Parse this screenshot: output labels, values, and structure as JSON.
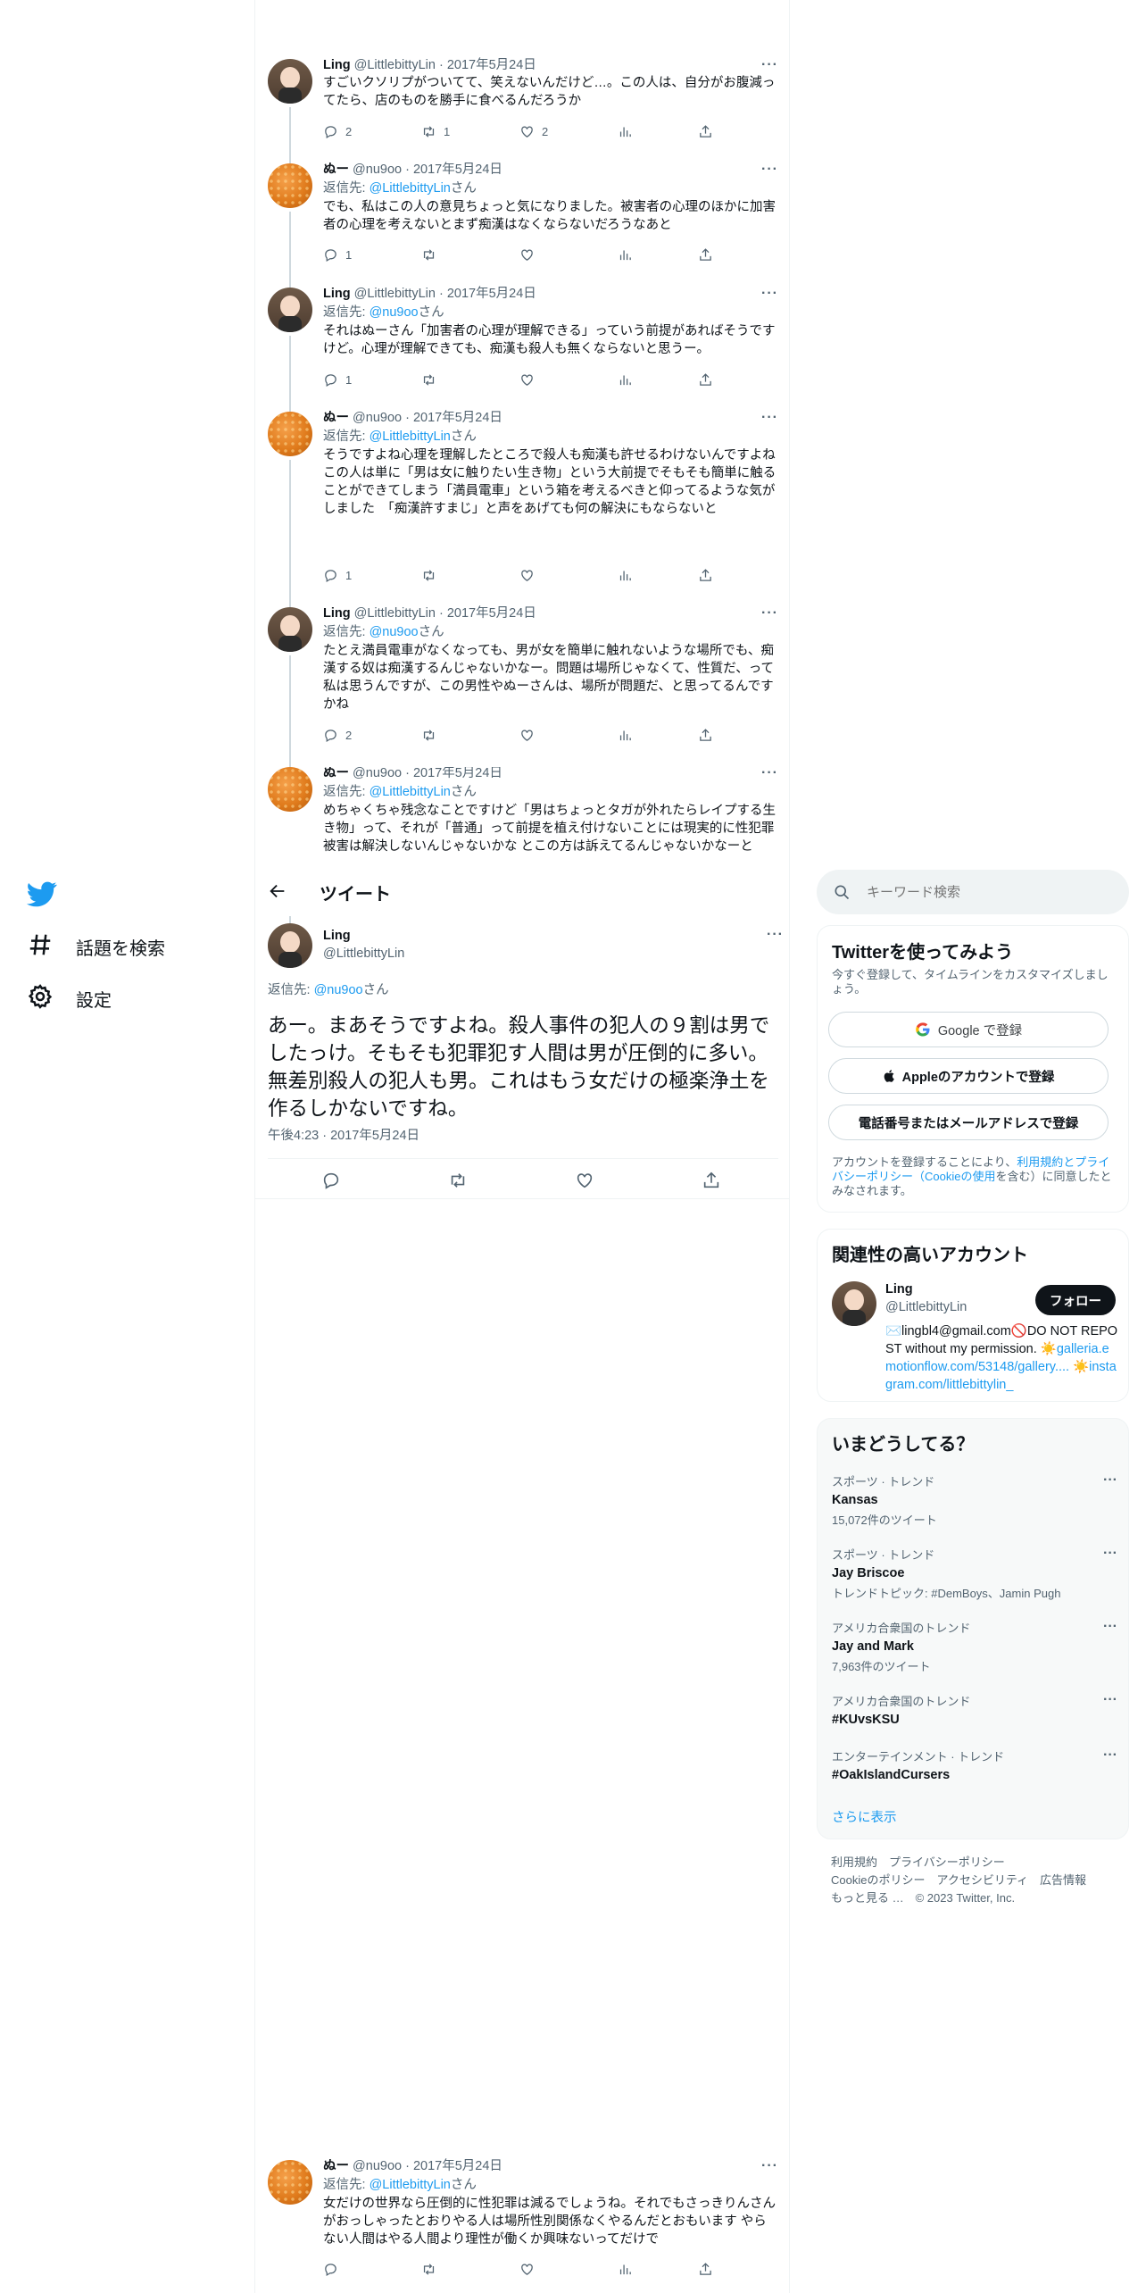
{
  "nav": {
    "explore_label": "話題を検索",
    "settings_label": "設定"
  },
  "thread": [
    {
      "author": "Ling",
      "handle": "@LittlebittyLin",
      "date": "· 2017年5月24日",
      "reply_prefix": "",
      "reply_handle": "",
      "reply_suffix": "",
      "text": "すごいクソリプがついてて、笑えないんだけど…。この人は、自分がお腹減ってたら、店のものを勝手に食べるんだろうか",
      "replies": "2",
      "retweets": "1",
      "likes": "2"
    },
    {
      "author": "ぬー",
      "handle": "@nu9oo",
      "date": "· 2017年5月24日",
      "reply_prefix": "返信先: ",
      "reply_handle": "@LittlebittyLin",
      "reply_suffix": "さん",
      "text": "でも、私はこの人の意見ちょっと気になりました。被害者の心理のほかに加害者の心理を考えないとまず痴漢はなくならないだろうなあと",
      "replies": "1",
      "retweets": "",
      "likes": ""
    },
    {
      "author": "Ling",
      "handle": "@LittlebittyLin",
      "date": "· 2017年5月24日",
      "reply_prefix": "返信先: ",
      "reply_handle": "@nu9oo",
      "reply_suffix": "さん",
      "text": "それはぬーさん「加害者の心理が理解できる」っていう前提があればそうですけど。心理が理解できても、痴漢も殺人も無くならないと思うー。",
      "replies": "1",
      "retweets": "",
      "likes": ""
    },
    {
      "author": "ぬー",
      "handle": "@nu9oo",
      "date": "· 2017年5月24日",
      "reply_prefix": "返信先: ",
      "reply_handle": "@LittlebittyLin",
      "reply_suffix": "さん",
      "text": "そうですよね心理を理解したところで殺人も痴漢も許せるわけないんですよね\nこの人は単に「男は女に触りたい生き物」という大前提でそもそも簡単に触ることができてしまう「満員電車」という箱を考えるべきと仰ってるような気がしました　「痴漢許すまじ」と声をあげても何の解決にもならないと",
      "replies": "1",
      "retweets": "",
      "likes": ""
    },
    {
      "author": "Ling",
      "handle": "@LittlebittyLin",
      "date": "· 2017年5月24日",
      "reply_prefix": "返信先: ",
      "reply_handle": "@nu9oo",
      "reply_suffix": "さん",
      "text": "たとえ満員電車がなくなっても、男が女を簡単に触れないような場所でも、痴漢する奴は痴漢するんじゃないかなー。問題は場所じゃなくて、性質だ、って私は思うんですが、この男性やぬーさんは、場所が問題だ、と思ってるんですかね",
      "replies": "2",
      "retweets": "",
      "likes": ""
    },
    {
      "author": "ぬー",
      "handle": "@nu9oo",
      "date": "· 2017年5月24日",
      "reply_prefix": "返信先: ",
      "reply_handle": "@LittlebittyLin",
      "reply_suffix": "さん",
      "text": "めちゃくちゃ残念なことですけど「男はちょっとタガが外れたらレイプする生き物」って、それが「普通」って前提を植え付けないことには現実的に性犯罪被害は解決しないんじゃないかな とこの方は訴えてるんじゃないかなーと",
      "replies": "",
      "retweets": "",
      "likes": ""
    }
  ],
  "header": {
    "title": "ツイート"
  },
  "main_tweet": {
    "author": "Ling",
    "handle": "@LittlebittyLin",
    "reply_prefix": "返信先: ",
    "reply_handle": "@nu9oo",
    "reply_suffix": "さん",
    "text": "あー。まあそうですよね。殺人事件の犯人の９割は男でしたっけ。そもそも犯罪犯す人間は男が圧倒的に多い。無差別殺人の犯人も男。これはもう女だけの極楽浄土を作るしかないですね。",
    "timestamp": "午後4:23 · 2017年5月24日"
  },
  "bottom_tweet": {
    "author": "ぬー",
    "handle": "@nu9oo",
    "date": "· 2017年5月24日",
    "reply_prefix": "返信先: ",
    "reply_handle": "@LittlebittyLin",
    "reply_suffix": "さん",
    "text": "女だけの世界なら圧倒的に性犯罪は減るでしょうね。それでもさっきりんさんがおっしゃったとおりやる人は場所性別関係なくやるんだとおもいます やらない人間はやる人間より理性が働くか興味ないってだけで"
  },
  "search": {
    "placeholder": "キーワード検索"
  },
  "signup": {
    "title": "Twitterを使ってみよう",
    "subtitle": "今すぐ登録して、タイムラインをカスタマイズしましょう。",
    "google_label": "Google で登録",
    "apple_label": "Appleのアカウントで登録",
    "phone_label": "電話番号またはメールアドレスで登録",
    "terms_prefix": "アカウントを登録することにより、",
    "terms_link": "利用規約とプライバシーポリシー（Cookieの使用",
    "terms_suffix": "を含む）に同意したとみなされます。"
  },
  "relevant": {
    "title": "関連性の高いアカウント",
    "name": "Ling",
    "handle": "@LittlebittyLin",
    "follow_label": "フォロー",
    "bio_line1": "✉️lingbl4@gmail.com🚫DO NOT REPOST without my permission. ☀️",
    "bio_link1": "galleria.emotionflow.com/53148/gallery....",
    "bio_link2": " ☀️instagram.com/littlebittylin_"
  },
  "trends": {
    "title": "いまどうしてる？",
    "items": [
      {
        "category": "スポーツ · トレンド",
        "name": "Kansas",
        "count": "15,072件のツイート"
      },
      {
        "category": "スポーツ · トレンド",
        "name": "Jay Briscoe",
        "count": "トレンドトピック: #DemBoys、Jamin Pugh"
      },
      {
        "category": "アメリカ合衆国のトレンド",
        "name": "Jay and Mark",
        "count": "7,963件のツイート"
      },
      {
        "category": "アメリカ合衆国のトレンド",
        "name": "#KUvsKSU",
        "count": ""
      },
      {
        "category": "エンターテインメント · トレンド",
        "name": "#OakIslandCursers",
        "count": ""
      }
    ],
    "show_more": "さらに表示"
  },
  "footer": {
    "line1": "利用規約　プライバシーポリシー",
    "line2": "Cookieのポリシー　アクセシビリティ　広告情報",
    "line3": "もっと見る …　© 2023 Twitter, Inc."
  },
  "colors": {
    "accent": "#1d9bf0",
    "text_primary": "#0f1419",
    "text_secondary": "#536471",
    "border": "#eff3f4"
  }
}
